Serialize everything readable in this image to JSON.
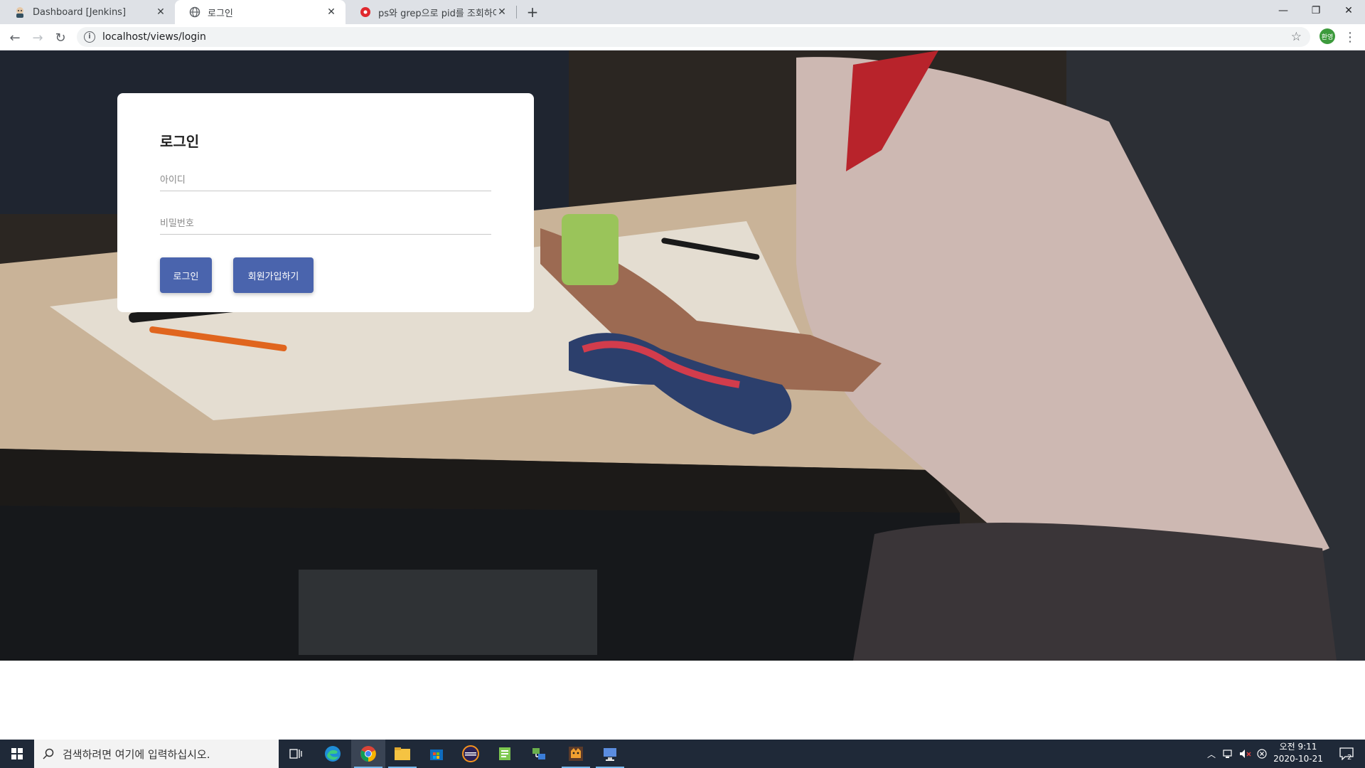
{
  "browser": {
    "tabs": [
      {
        "title": "Dashboard [Jenkins]",
        "favicon": "jenkins-icon"
      },
      {
        "title": "로그인",
        "favicon": "globe-icon"
      },
      {
        "title": "ps와 grep으로 pid를 조회하여",
        "favicon": "red-site-icon"
      }
    ],
    "active_tab": 1,
    "url": "localhost/views/login",
    "profile_label": "환영"
  },
  "login": {
    "title": "로그인",
    "username_placeholder": "아이디",
    "password_placeholder": "비밀번호",
    "login_button": "로그인",
    "signup_button": "회원가입하기",
    "accent_color": "#4a64ad"
  },
  "taskbar": {
    "search_placeholder": "검색하려면 여기에 입력하십시오.",
    "clock_time": "오전 9:11",
    "clock_date": "2020-10-21",
    "notification_count": "2"
  }
}
